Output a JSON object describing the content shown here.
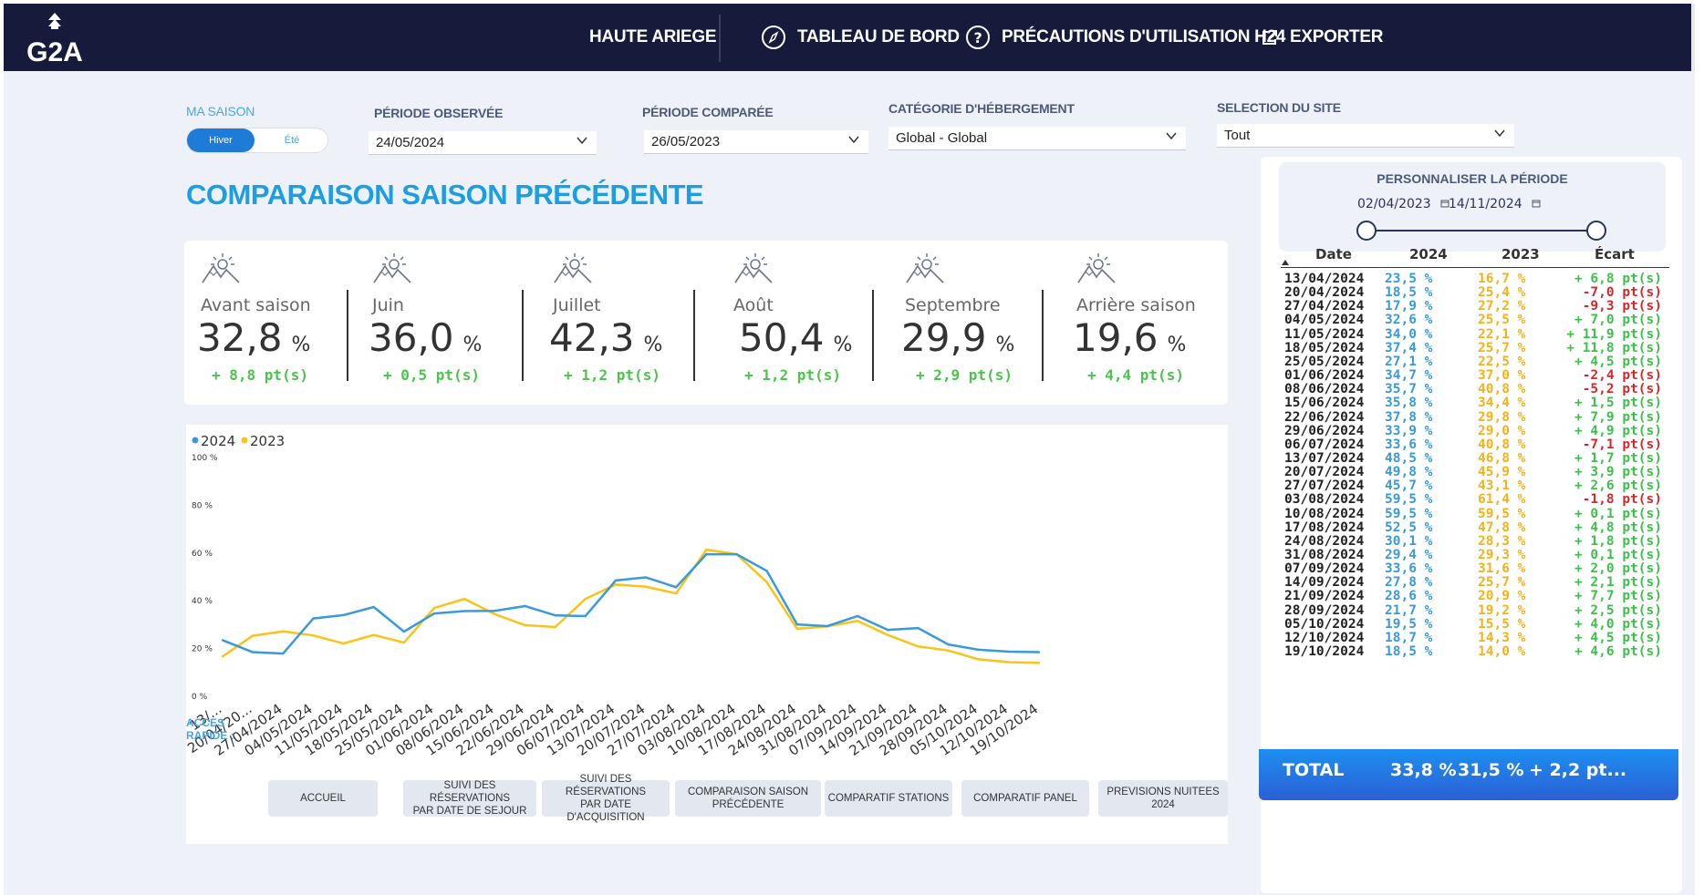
{
  "header": {
    "logo_text": "G2A",
    "nav": [
      "HAUTE ARIEGE",
      "TABLEAU DE BORD",
      "PRÉCAUTIONS D'UTILISATION H24",
      "EXPORTER"
    ]
  },
  "filters": {
    "season_label": "MA SAISON",
    "season_options": [
      "Hiver",
      "Été"
    ],
    "observed_label": "PÉRIODE OBSERVÉE",
    "observed_value": "24/05/2024",
    "compared_label": "PÉRIODE COMPARÉE",
    "compared_value": "26/05/2023",
    "category_label": "CATÉGORIE D'HÉBERGEMENT",
    "category_value": "Global - Global",
    "site_label": "SELECTION DU SITE",
    "site_value": "Tout"
  },
  "section_title": "COMPARAISON SAISON PRÉCÉDENTE",
  "kpis": [
    {
      "label": "Avant saison",
      "value": "32,8",
      "unit": "%",
      "delta": "+ 8,8 pt(s)"
    },
    {
      "label": "Juin",
      "value": "36,0",
      "unit": "%",
      "delta": "+ 0,5 pt(s)"
    },
    {
      "label": "Juillet",
      "value": "42,3",
      "unit": "%",
      "delta": "+ 1,2 pt(s)"
    },
    {
      "label": "Août",
      "value": "50,4",
      "unit": "%",
      "delta": "+ 1,2 pt(s)"
    },
    {
      "label": "Septembre",
      "value": "29,9",
      "unit": "%",
      "delta": "+ 2,9 pt(s)"
    },
    {
      "label": "Arrière saison",
      "value": "19,6",
      "unit": "%",
      "delta": "+ 4,4 pt(s)"
    }
  ],
  "chart_data": {
    "type": "line",
    "categories": [
      "13/...",
      "20/04/20...",
      "27/04/2024",
      "04/05/2024",
      "11/05/2024",
      "18/05/2024",
      "25/05/2024",
      "01/06/2024",
      "08/06/2024",
      "15/06/2024",
      "22/06/2024",
      "29/06/2024",
      "06/07/2024",
      "13/07/2024",
      "20/07/2024",
      "27/07/2024",
      "03/08/2024",
      "10/08/2024",
      "17/08/2024",
      "24/08/2024",
      "31/08/2024",
      "07/09/2024",
      "14/09/2024",
      "21/09/2024",
      "28/09/2024",
      "05/10/2024",
      "12/10/2024",
      "19/10/2024"
    ],
    "series": [
      {
        "name": "2024",
        "color": "#3a9ad9",
        "values": [
          23.5,
          18.5,
          17.9,
          32.6,
          34.0,
          37.4,
          27.1,
          34.7,
          35.7,
          35.8,
          37.8,
          33.9,
          33.6,
          48.5,
          49.8,
          45.7,
          59.5,
          59.5,
          52.5,
          30.1,
          29.4,
          33.6,
          27.8,
          28.6,
          21.7,
          19.5,
          18.7,
          18.5
        ]
      },
      {
        "name": "2023",
        "color": "#f9c31a",
        "values": [
          16.7,
          25.4,
          27.2,
          25.5,
          22.1,
          25.7,
          22.5,
          37.0,
          40.8,
          34.4,
          29.8,
          29.0,
          40.8,
          46.8,
          45.9,
          43.1,
          61.4,
          59.5,
          47.8,
          28.3,
          29.3,
          31.6,
          25.7,
          20.9,
          19.2,
          15.5,
          14.3,
          14.0
        ]
      }
    ],
    "y_ticks": [
      "0 %",
      "20 %",
      "40 %",
      "60 %",
      "80 %",
      "100 %"
    ],
    "ylim": [
      0,
      100
    ],
    "legend_position": "top-left"
  },
  "period_panel": {
    "title": "PERSONNALISER LA PÉRIODE",
    "start": "02/04/2023",
    "end": "14/11/2024"
  },
  "table": {
    "headers": [
      "Date",
      "2024",
      "2023",
      "Écart"
    ],
    "rows": [
      [
        "13/04/2024",
        "23,5 %",
        "16,7 %",
        "+ 6,8 pt(s)"
      ],
      [
        "20/04/2024",
        "18,5 %",
        "25,4 %",
        "-7,0 pt(s)"
      ],
      [
        "27/04/2024",
        "17,9 %",
        "27,2 %",
        "-9,3 pt(s)"
      ],
      [
        "04/05/2024",
        "32,6 %",
        "25,5 %",
        "+ 7,0 pt(s)"
      ],
      [
        "11/05/2024",
        "34,0 %",
        "22,1 %",
        "+ 11,9 pt(s)"
      ],
      [
        "18/05/2024",
        "37,4 %",
        "25,7 %",
        "+ 11,8 pt(s)"
      ],
      [
        "25/05/2024",
        "27,1 %",
        "22,5 %",
        "+ 4,5 pt(s)"
      ],
      [
        "01/06/2024",
        "34,7 %",
        "37,0 %",
        "-2,4 pt(s)"
      ],
      [
        "08/06/2024",
        "35,7 %",
        "40,8 %",
        "-5,2 pt(s)"
      ],
      [
        "15/06/2024",
        "35,8 %",
        "34,4 %",
        "+ 1,5 pt(s)"
      ],
      [
        "22/06/2024",
        "37,8 %",
        "29,8 %",
        "+ 7,9 pt(s)"
      ],
      [
        "29/06/2024",
        "33,9 %",
        "29,0 %",
        "+ 4,9 pt(s)"
      ],
      [
        "06/07/2024",
        "33,6 %",
        "40,8 %",
        "-7,1 pt(s)"
      ],
      [
        "13/07/2024",
        "48,5 %",
        "46,8 %",
        "+ 1,7 pt(s)"
      ],
      [
        "20/07/2024",
        "49,8 %",
        "45,9 %",
        "+ 3,9 pt(s)"
      ],
      [
        "27/07/2024",
        "45,7 %",
        "43,1 %",
        "+ 2,6 pt(s)"
      ],
      [
        "03/08/2024",
        "59,5 %",
        "61,4 %",
        "-1,8 pt(s)"
      ],
      [
        "10/08/2024",
        "59,5 %",
        "59,5 %",
        "+ 0,1 pt(s)"
      ],
      [
        "17/08/2024",
        "52,5 %",
        "47,8 %",
        "+ 4,8 pt(s)"
      ],
      [
        "24/08/2024",
        "30,1 %",
        "28,3 %",
        "+ 1,8 pt(s)"
      ],
      [
        "31/08/2024",
        "29,4 %",
        "29,3 %",
        "+ 0,1 pt(s)"
      ],
      [
        "07/09/2024",
        "33,6 %",
        "31,6 %",
        "+ 2,0 pt(s)"
      ],
      [
        "14/09/2024",
        "27,8 %",
        "25,7 %",
        "+ 2,1 pt(s)"
      ],
      [
        "21/09/2024",
        "28,6 %",
        "20,9 %",
        "+ 7,7 pt(s)"
      ],
      [
        "28/09/2024",
        "21,7 %",
        "19,2 %",
        "+ 2,5 pt(s)"
      ],
      [
        "05/10/2024",
        "19,5 %",
        "15,5 %",
        "+ 4,0 pt(s)"
      ],
      [
        "12/10/2024",
        "18,7 %",
        "14,3 %",
        "+ 4,5 pt(s)"
      ],
      [
        "19/10/2024",
        "18,5 %",
        "14,0 %",
        "+ 4,6 pt(s)"
      ]
    ]
  },
  "total": {
    "label": "TOTAL",
    "y2024": "33,8 %",
    "y2023": "31,5 %",
    "diff": "+ 2,2 pt..."
  },
  "quick_access": {
    "label_line1": "ACCES",
    "label_line2": "RAPIDE :",
    "buttons": [
      [
        "ACCUEIL"
      ],
      [
        "SUIVI DES RÉSERVATIONS",
        "PAR DATE DE SEJOUR"
      ],
      [
        "SUIVI DES RÉSERVATIONS",
        "PAR DATE D'ACQUISITION"
      ],
      [
        "COMPARAISON SAISON",
        "PRÉCÉDENTE"
      ],
      [
        "COMPARATIF STATIONS"
      ],
      [
        "COMPARATIF PANEL"
      ],
      [
        "PREVISIONS NUITEES 2024"
      ]
    ]
  },
  "colors": {
    "header_bg": "#161b3b",
    "accent": "#1d9ee0",
    "series_2024": "#3a9ad9",
    "series_2023": "#f9c31a",
    "positive": "#3cc14a",
    "negative": "#d8272b"
  }
}
